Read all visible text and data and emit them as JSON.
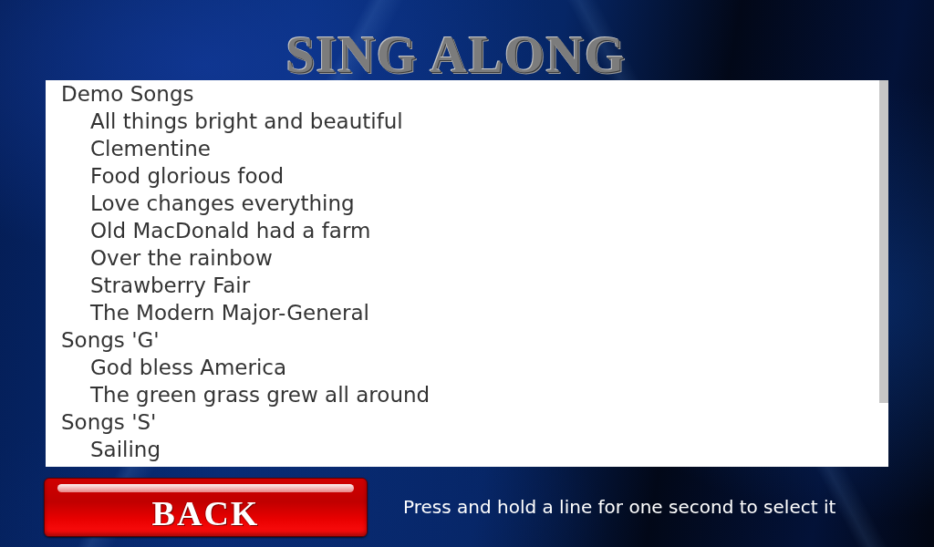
{
  "title": "SING ALONG",
  "song_list": {
    "groups": [
      {
        "label": "Demo Songs",
        "children": [
          {
            "label": "All things bright and beautiful"
          },
          {
            "label": "Clementine"
          },
          {
            "label": "Food glorious food"
          },
          {
            "label": "Love changes everything"
          },
          {
            "label": "Old MacDonald had a farm"
          },
          {
            "label": "Over the rainbow"
          },
          {
            "label": "Strawberry Fair"
          },
          {
            "label": "The Modern Major-General"
          }
        ]
      },
      {
        "label": "Songs 'G'",
        "children": [
          {
            "label": "God bless America"
          },
          {
            "label": "The green grass grew all around"
          }
        ]
      },
      {
        "label": "Songs 'S'",
        "children": [
          {
            "label": "Sailing"
          }
        ]
      }
    ]
  },
  "back_button": {
    "label": "BACK"
  },
  "hint": "Press and hold a line for one second to select it"
}
